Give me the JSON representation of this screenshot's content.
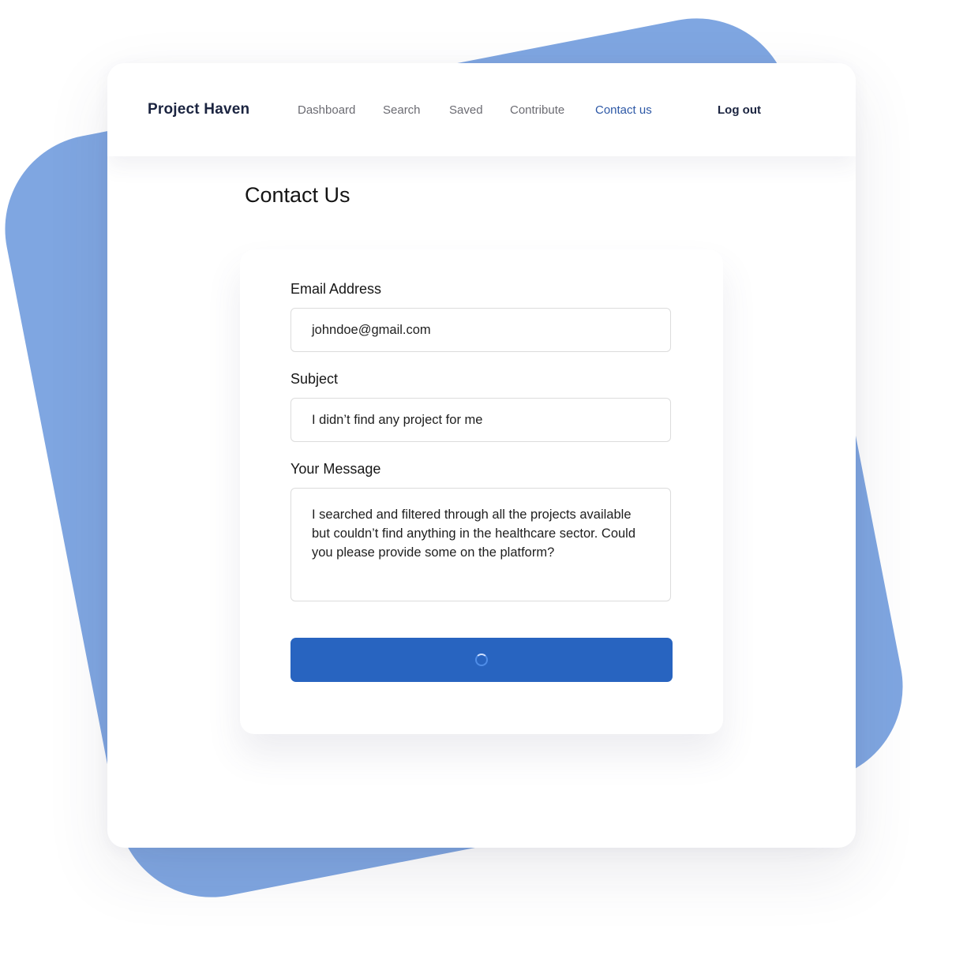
{
  "app": {
    "brand": "Project Haven"
  },
  "nav": {
    "items": [
      {
        "label": "Dashboard",
        "active": false
      },
      {
        "label": "Search",
        "active": false
      },
      {
        "label": "Saved",
        "active": false
      },
      {
        "label": "Contribute",
        "active": false
      },
      {
        "label": "Contact us",
        "active": true
      }
    ],
    "logout_label": "Log out"
  },
  "page": {
    "title": "Contact Us"
  },
  "form": {
    "email": {
      "label": "Email Address",
      "value": "johndoe@gmail.com"
    },
    "subject": {
      "label": "Subject",
      "value": "I didn’t find any project for me"
    },
    "message": {
      "label": "Your Message",
      "value": "I searched and filtered through all the projects available but couldn’t find anything in the healthcare sector. Could you please provide some on the platform?"
    },
    "submit": {
      "state": "loading",
      "icon": "spinner-icon"
    }
  },
  "colors": {
    "accent": "#2864c0",
    "nav_active": "#2d58a6",
    "background_shape": "#7fa6e1",
    "brand_text": "#1b2440"
  }
}
